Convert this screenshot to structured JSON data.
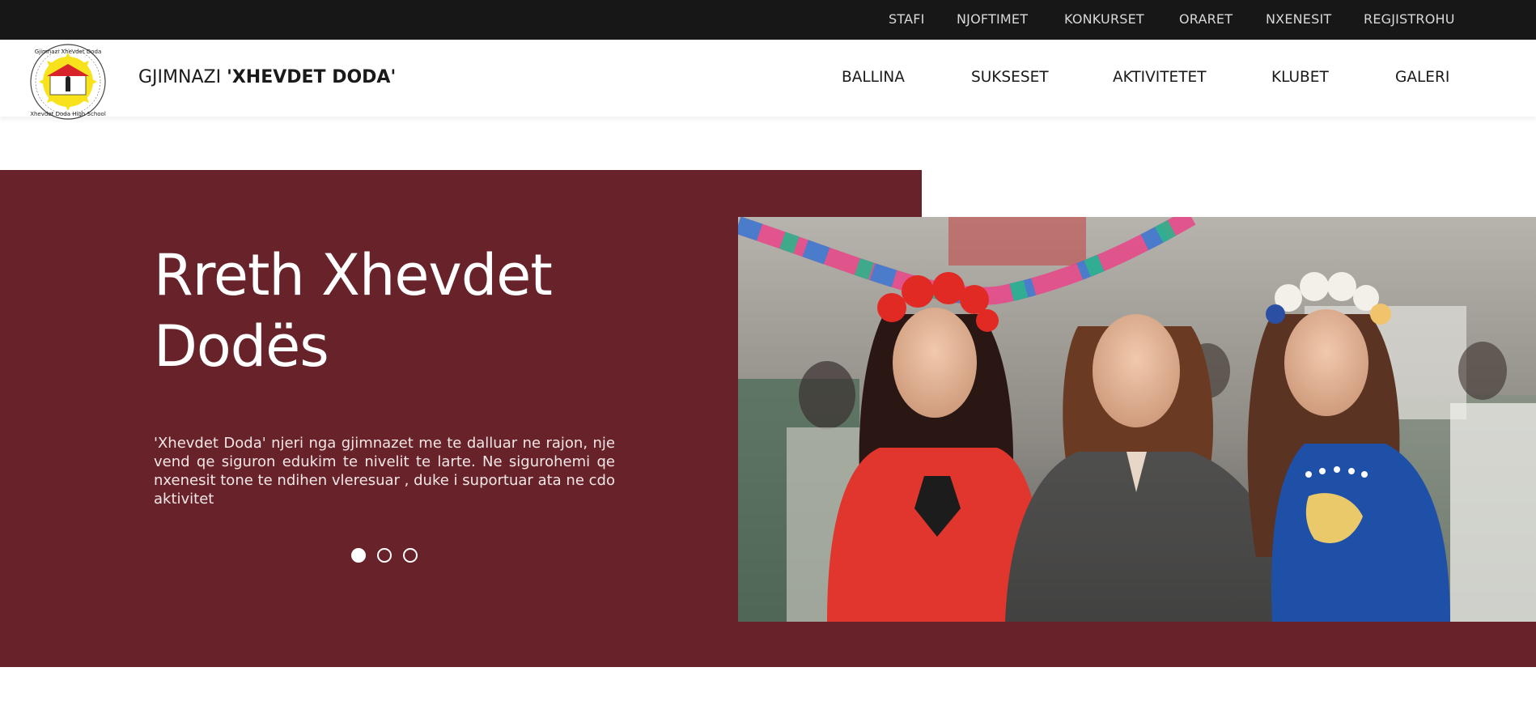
{
  "topbar": {
    "links": [
      "STAFI",
      "NJOFTIMET",
      "KONKURSET",
      "ORARET",
      "NXENESIT",
      "REGJISTROHU"
    ]
  },
  "header": {
    "logo_name": "school-logo",
    "logo_text": "Gjimnazi \"Xhevdet Doda\" · \"Xhevdet Doda\" High School",
    "brand_prefix": "GJIMNAZI ",
    "brand_name": "'XHEVDET DODA'",
    "nav": [
      "BALLINA",
      "SUKSESET",
      "AKTIVITETET",
      "KLUBET",
      "GALERI"
    ]
  },
  "hero": {
    "title": "Rreth Xhevdet Dodës",
    "text": "'Xhevdet Doda' njeri nga gjimnazet me te dalluar ne rajon, nje vend qe siguron edukim te nivelit te larte. Ne sigurohemi qe nxenesit tone te ndihen vleresuar , duke i suportuar ata ne cdo aktivitet",
    "slides": 3,
    "active_slide": 1,
    "photo": "three-women-with-flower-crowns-photo"
  },
  "colors": {
    "topbar": "#171717",
    "hero": "#68232a",
    "text_dark": "#1a1a1a"
  }
}
